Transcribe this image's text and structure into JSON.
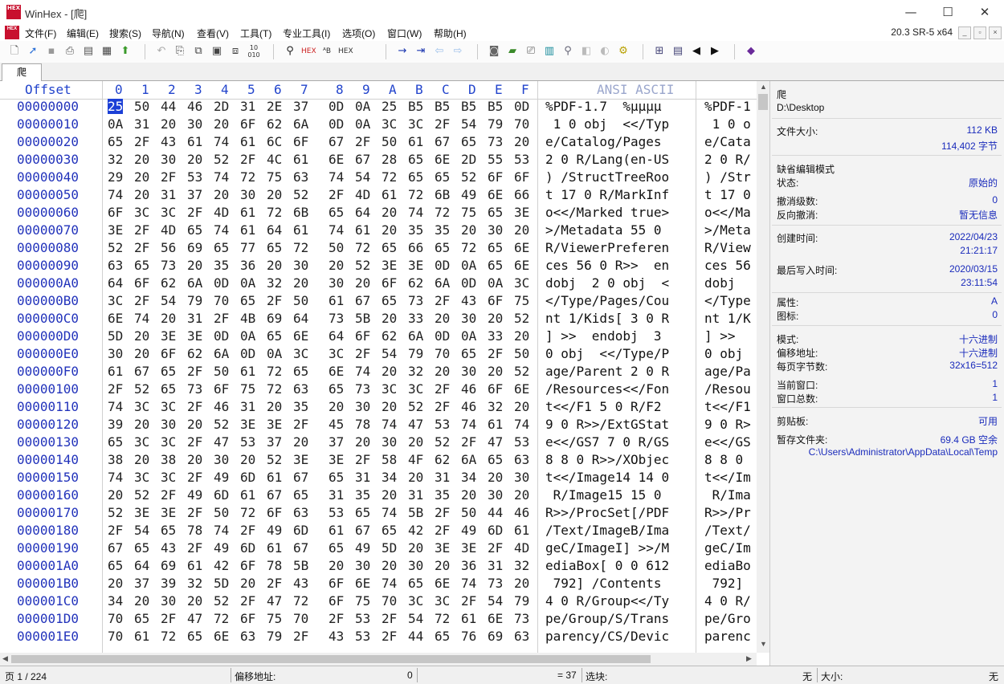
{
  "window": {
    "title": "WinHex - [爬]",
    "logo_text": "HEX",
    "minimize": "—",
    "maximize": "☐",
    "close": "✕"
  },
  "menu": {
    "items": [
      "文件(F)",
      "编辑(E)",
      "搜索(S)",
      "导航(N)",
      "查看(V)",
      "工具(T)",
      "专业工具(I)",
      "选项(O)",
      "窗口(W)",
      "帮助(H)"
    ],
    "version": "20.3 SR-5 x64"
  },
  "toolbar": {
    "icons": [
      "new-file-icon",
      "open-icon",
      "save-icon",
      "print-icon",
      "properties-icon",
      "undo-icon",
      "copy-icon",
      "paste-icon",
      "paste-block-icon",
      "paste-write-icon",
      "hex-convert-icon",
      "find-icon",
      "find-hex-icon",
      "replace-text-icon",
      "replace-hex-icon",
      "goto-offset-icon",
      "goto-end-icon",
      "back-icon",
      "forward-icon",
      "open-disk-icon",
      "open-ram-icon",
      "clone-icon",
      "calculator-icon",
      "hash-icon",
      "refresh-icon",
      "analyze-icon",
      "grid-icon",
      "list-icon",
      "prev-icon",
      "next-icon",
      "help-book-icon"
    ]
  },
  "tabs": [
    {
      "label": "爬"
    }
  ],
  "hex": {
    "offset_header": "Offset",
    "columns": [
      "0",
      "1",
      "2",
      "3",
      "4",
      "5",
      "6",
      "7",
      "8",
      "9",
      "A",
      "B",
      "C",
      "D",
      "E",
      "F"
    ],
    "ascii_header": "ANSI ASCII",
    "rows": [
      {
        "offset": "00000000",
        "bytes": [
          "25",
          "50",
          "44",
          "46",
          "2D",
          "31",
          "2E",
          "37",
          "0D",
          "0A",
          "25",
          "B5",
          "B5",
          "B5",
          "B5",
          "0D"
        ],
        "ascii": "%PDF-1.7  %µµµµ",
        "ascii2": "%PDF-1"
      },
      {
        "offset": "00000010",
        "bytes": [
          "0A",
          "31",
          "20",
          "30",
          "20",
          "6F",
          "62",
          "6A",
          "0D",
          "0A",
          "3C",
          "3C",
          "2F",
          "54",
          "79",
          "70"
        ],
        "ascii": " 1 0 obj  <</Typ",
        "ascii2": " 1 0 o"
      },
      {
        "offset": "00000020",
        "bytes": [
          "65",
          "2F",
          "43",
          "61",
          "74",
          "61",
          "6C",
          "6F",
          "67",
          "2F",
          "50",
          "61",
          "67",
          "65",
          "73",
          "20"
        ],
        "ascii": "e/Catalog/Pages ",
        "ascii2": "e/Cata"
      },
      {
        "offset": "00000030",
        "bytes": [
          "32",
          "20",
          "30",
          "20",
          "52",
          "2F",
          "4C",
          "61",
          "6E",
          "67",
          "28",
          "65",
          "6E",
          "2D",
          "55",
          "53"
        ],
        "ascii": "2 0 R/Lang(en-US",
        "ascii2": "2 0 R/"
      },
      {
        "offset": "00000040",
        "bytes": [
          "29",
          "20",
          "2F",
          "53",
          "74",
          "72",
          "75",
          "63",
          "74",
          "54",
          "72",
          "65",
          "65",
          "52",
          "6F",
          "6F"
        ],
        "ascii": ") /StructTreeRoo",
        "ascii2": ") /Str"
      },
      {
        "offset": "00000050",
        "bytes": [
          "74",
          "20",
          "31",
          "37",
          "20",
          "30",
          "20",
          "52",
          "2F",
          "4D",
          "61",
          "72",
          "6B",
          "49",
          "6E",
          "66"
        ],
        "ascii": "t 17 0 R/MarkInf",
        "ascii2": "t 17 0"
      },
      {
        "offset": "00000060",
        "bytes": [
          "6F",
          "3C",
          "3C",
          "2F",
          "4D",
          "61",
          "72",
          "6B",
          "65",
          "64",
          "20",
          "74",
          "72",
          "75",
          "65",
          "3E"
        ],
        "ascii": "o<</Marked true>",
        "ascii2": "o<</Ma"
      },
      {
        "offset": "00000070",
        "bytes": [
          "3E",
          "2F",
          "4D",
          "65",
          "74",
          "61",
          "64",
          "61",
          "74",
          "61",
          "20",
          "35",
          "35",
          "20",
          "30",
          "20"
        ],
        "ascii": ">/Metadata 55 0 ",
        "ascii2": ">/Meta"
      },
      {
        "offset": "00000080",
        "bytes": [
          "52",
          "2F",
          "56",
          "69",
          "65",
          "77",
          "65",
          "72",
          "50",
          "72",
          "65",
          "66",
          "65",
          "72",
          "65",
          "6E"
        ],
        "ascii": "R/ViewerPreferen",
        "ascii2": "R/View"
      },
      {
        "offset": "00000090",
        "bytes": [
          "63",
          "65",
          "73",
          "20",
          "35",
          "36",
          "20",
          "30",
          "20",
          "52",
          "3E",
          "3E",
          "0D",
          "0A",
          "65",
          "6E"
        ],
        "ascii": "ces 56 0 R>>  en",
        "ascii2": "ces 56"
      },
      {
        "offset": "000000A0",
        "bytes": [
          "64",
          "6F",
          "62",
          "6A",
          "0D",
          "0A",
          "32",
          "20",
          "30",
          "20",
          "6F",
          "62",
          "6A",
          "0D",
          "0A",
          "3C"
        ],
        "ascii": "dobj  2 0 obj  <",
        "ascii2": "dobj  "
      },
      {
        "offset": "000000B0",
        "bytes": [
          "3C",
          "2F",
          "54",
          "79",
          "70",
          "65",
          "2F",
          "50",
          "61",
          "67",
          "65",
          "73",
          "2F",
          "43",
          "6F",
          "75"
        ],
        "ascii": "</Type/Pages/Cou",
        "ascii2": "</Type"
      },
      {
        "offset": "000000C0",
        "bytes": [
          "6E",
          "74",
          "20",
          "31",
          "2F",
          "4B",
          "69",
          "64",
          "73",
          "5B",
          "20",
          "33",
          "20",
          "30",
          "20",
          "52"
        ],
        "ascii": "nt 1/Kids[ 3 0 R",
        "ascii2": "nt 1/K"
      },
      {
        "offset": "000000D0",
        "bytes": [
          "5D",
          "20",
          "3E",
          "3E",
          "0D",
          "0A",
          "65",
          "6E",
          "64",
          "6F",
          "62",
          "6A",
          "0D",
          "0A",
          "33",
          "20"
        ],
        "ascii": "] >>  endobj  3 ",
        "ascii2": "] >>  "
      },
      {
        "offset": "000000E0",
        "bytes": [
          "30",
          "20",
          "6F",
          "62",
          "6A",
          "0D",
          "0A",
          "3C",
          "3C",
          "2F",
          "54",
          "79",
          "70",
          "65",
          "2F",
          "50"
        ],
        "ascii": "0 obj  <</Type/P",
        "ascii2": "0 obj "
      },
      {
        "offset": "000000F0",
        "bytes": [
          "61",
          "67",
          "65",
          "2F",
          "50",
          "61",
          "72",
          "65",
          "6E",
          "74",
          "20",
          "32",
          "20",
          "30",
          "20",
          "52"
        ],
        "ascii": "age/Parent 2 0 R",
        "ascii2": "age/Pa"
      },
      {
        "offset": "00000100",
        "bytes": [
          "2F",
          "52",
          "65",
          "73",
          "6F",
          "75",
          "72",
          "63",
          "65",
          "73",
          "3C",
          "3C",
          "2F",
          "46",
          "6F",
          "6E"
        ],
        "ascii": "/Resources<</Fon",
        "ascii2": "/Resou"
      },
      {
        "offset": "00000110",
        "bytes": [
          "74",
          "3C",
          "3C",
          "2F",
          "46",
          "31",
          "20",
          "35",
          "20",
          "30",
          "20",
          "52",
          "2F",
          "46",
          "32",
          "20"
        ],
        "ascii": "t<</F1 5 0 R/F2 ",
        "ascii2": "t<</F1"
      },
      {
        "offset": "00000120",
        "bytes": [
          "39",
          "20",
          "30",
          "20",
          "52",
          "3E",
          "3E",
          "2F",
          "45",
          "78",
          "74",
          "47",
          "53",
          "74",
          "61",
          "74"
        ],
        "ascii": "9 0 R>>/ExtGStat",
        "ascii2": "9 0 R>"
      },
      {
        "offset": "00000130",
        "bytes": [
          "65",
          "3C",
          "3C",
          "2F",
          "47",
          "53",
          "37",
          "20",
          "37",
          "20",
          "30",
          "20",
          "52",
          "2F",
          "47",
          "53"
        ],
        "ascii": "e<</GS7 7 0 R/GS",
        "ascii2": "e<</GS"
      },
      {
        "offset": "00000140",
        "bytes": [
          "38",
          "20",
          "38",
          "20",
          "30",
          "20",
          "52",
          "3E",
          "3E",
          "2F",
          "58",
          "4F",
          "62",
          "6A",
          "65",
          "63"
        ],
        "ascii": "8 8 0 R>>/XObjec",
        "ascii2": "8 8 0 "
      },
      {
        "offset": "00000150",
        "bytes": [
          "74",
          "3C",
          "3C",
          "2F",
          "49",
          "6D",
          "61",
          "67",
          "65",
          "31",
          "34",
          "20",
          "31",
          "34",
          "20",
          "30"
        ],
        "ascii": "t<</Image14 14 0",
        "ascii2": "t<</Im"
      },
      {
        "offset": "00000160",
        "bytes": [
          "20",
          "52",
          "2F",
          "49",
          "6D",
          "61",
          "67",
          "65",
          "31",
          "35",
          "20",
          "31",
          "35",
          "20",
          "30",
          "20"
        ],
        "ascii": " R/Image15 15 0 ",
        "ascii2": " R/Ima"
      },
      {
        "offset": "00000170",
        "bytes": [
          "52",
          "3E",
          "3E",
          "2F",
          "50",
          "72",
          "6F",
          "63",
          "53",
          "65",
          "74",
          "5B",
          "2F",
          "50",
          "44",
          "46"
        ],
        "ascii": "R>>/ProcSet[/PDF",
        "ascii2": "R>>/Pr"
      },
      {
        "offset": "00000180",
        "bytes": [
          "2F",
          "54",
          "65",
          "78",
          "74",
          "2F",
          "49",
          "6D",
          "61",
          "67",
          "65",
          "42",
          "2F",
          "49",
          "6D",
          "61"
        ],
        "ascii": "/Text/ImageB/Ima",
        "ascii2": "/Text/"
      },
      {
        "offset": "00000190",
        "bytes": [
          "67",
          "65",
          "43",
          "2F",
          "49",
          "6D",
          "61",
          "67",
          "65",
          "49",
          "5D",
          "20",
          "3E",
          "3E",
          "2F",
          "4D"
        ],
        "ascii": "geC/ImageI] >>/M",
        "ascii2": "geC/Im"
      },
      {
        "offset": "000001A0",
        "bytes": [
          "65",
          "64",
          "69",
          "61",
          "42",
          "6F",
          "78",
          "5B",
          "20",
          "30",
          "20",
          "30",
          "20",
          "36",
          "31",
          "32"
        ],
        "ascii": "ediaBox[ 0 0 612",
        "ascii2": "ediaBo"
      },
      {
        "offset": "000001B0",
        "bytes": [
          "20",
          "37",
          "39",
          "32",
          "5D",
          "20",
          "2F",
          "43",
          "6F",
          "6E",
          "74",
          "65",
          "6E",
          "74",
          "73",
          "20"
        ],
        "ascii": " 792] /Contents ",
        "ascii2": " 792] "
      },
      {
        "offset": "000001C0",
        "bytes": [
          "34",
          "20",
          "30",
          "20",
          "52",
          "2F",
          "47",
          "72",
          "6F",
          "75",
          "70",
          "3C",
          "3C",
          "2F",
          "54",
          "79"
        ],
        "ascii": "4 0 R/Group<</Ty",
        "ascii2": "4 0 R/"
      },
      {
        "offset": "000001D0",
        "bytes": [
          "70",
          "65",
          "2F",
          "47",
          "72",
          "6F",
          "75",
          "70",
          "2F",
          "53",
          "2F",
          "54",
          "72",
          "61",
          "6E",
          "73"
        ],
        "ascii": "pe/Group/S/Trans",
        "ascii2": "pe/Gro"
      },
      {
        "offset": "000001E0",
        "bytes": [
          "70",
          "61",
          "72",
          "65",
          "6E",
          "63",
          "79",
          "2F",
          "43",
          "53",
          "2F",
          "44",
          "65",
          "76",
          "69",
          "63"
        ],
        "ascii": "parency/CS/Devic",
        "ascii2": "parenc"
      }
    ]
  },
  "info": {
    "file_name": "爬",
    "path": "D:\\Desktop",
    "size_label": "文件大小:",
    "size_kb": "112 KB",
    "size_bytes": "114,402 字节",
    "edit_mode_title": "缺省编辑模式",
    "state_label": "状态:",
    "state_value": "原始的",
    "undo_level_label": "撤消级数:",
    "undo_level_value": "0",
    "undo_rev_label": "反向撤消:",
    "undo_rev_value": "暂无信息",
    "created_label": "创建时间:",
    "created_date": "2022/04/23",
    "created_time": "21:21:17",
    "modified_label": "最后写入时间:",
    "modified_date": "2020/03/15",
    "modified_time": "23:11:54",
    "attr_label": "属性:",
    "attr_value": "A",
    "icon_label": "图标:",
    "icon_value": "0",
    "mode_label": "模式:",
    "mode_value": "十六进制",
    "offset_label": "偏移地址:",
    "offset_value": "十六进制",
    "bpp_label": "每页字节数:",
    "bpp_value": "32x16=512",
    "curwin_label": "当前窗口:",
    "curwin_value": "1",
    "totwin_label": "窗口总数:",
    "totwin_value": "1",
    "clip_label": "剪贴板:",
    "clip_value": "可用",
    "temp_label": "暂存文件夹:",
    "temp_free": "69.4 GB 空余",
    "temp_path": "C:\\Users\\Administrator\\AppData\\Local\\Temp"
  },
  "status": {
    "page": "页 1 / 224",
    "offset_label": "偏移地址:",
    "offset_value": "0",
    "eq_value": "= 37",
    "block_label": "选块:",
    "block_value": "无",
    "size_label": "大小:",
    "size_value": "无"
  }
}
